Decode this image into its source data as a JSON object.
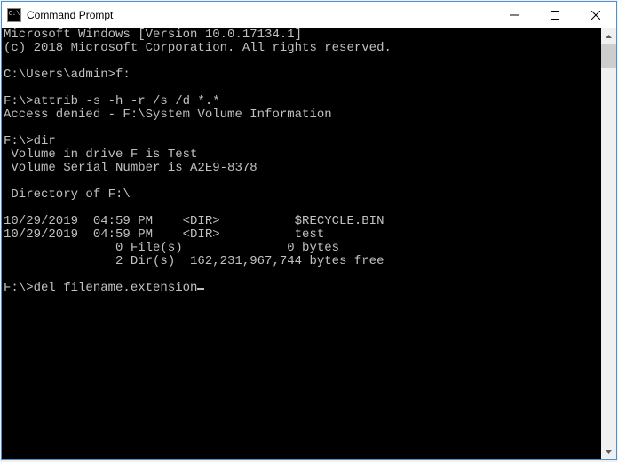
{
  "window": {
    "title": "Command Prompt"
  },
  "console": {
    "lines": [
      "Microsoft Windows [Version 10.0.17134.1]",
      "(c) 2018 Microsoft Corporation. All rights reserved.",
      "",
      "C:\\Users\\admin>f:",
      "",
      "F:\\>attrib -s -h -r /s /d *.*",
      "Access denied - F:\\System Volume Information",
      "",
      "F:\\>dir",
      " Volume in drive F is Test",
      " Volume Serial Number is A2E9-8378",
      "",
      " Directory of F:\\",
      "",
      "10/29/2019  04:59 PM    <DIR>          $RECYCLE.BIN",
      "10/29/2019  04:59 PM    <DIR>          test",
      "               0 File(s)              0 bytes",
      "               2 Dir(s)  162,231,967,744 bytes free",
      "",
      "F:\\>del filename.extension"
    ]
  }
}
